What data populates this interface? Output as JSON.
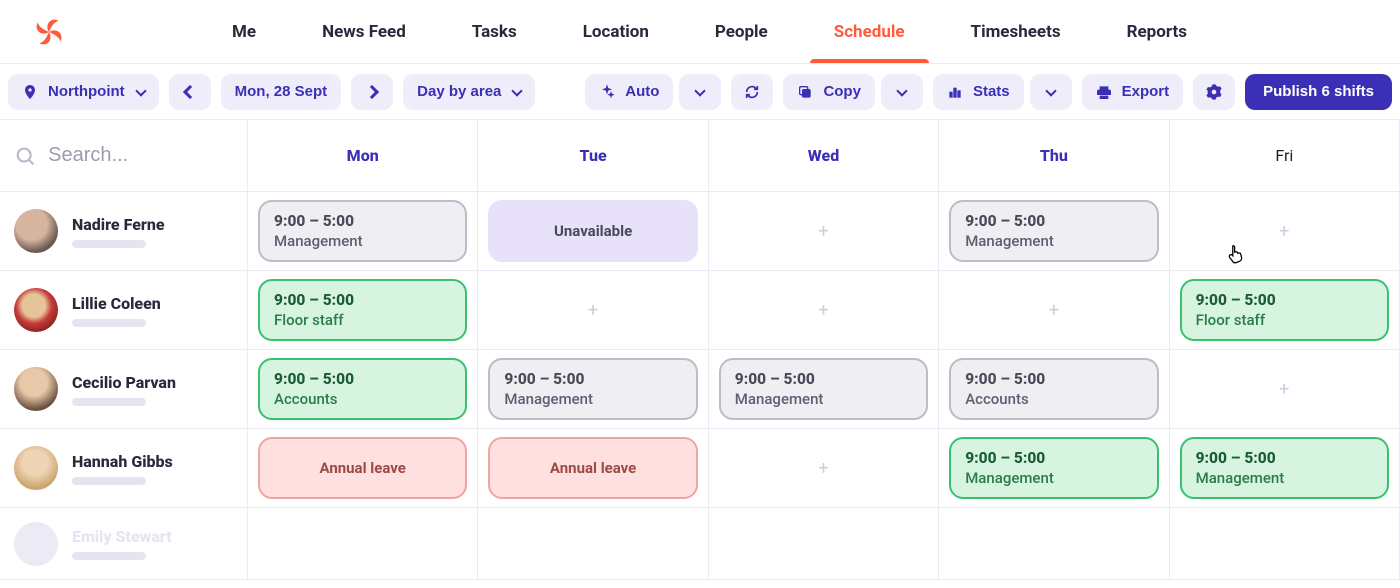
{
  "nav": {
    "tabs": [
      {
        "label": "Me",
        "active": false
      },
      {
        "label": "News Feed",
        "active": false
      },
      {
        "label": "Tasks",
        "active": false
      },
      {
        "label": "Location",
        "active": false
      },
      {
        "label": "People",
        "active": false
      },
      {
        "label": "Schedule",
        "active": true
      },
      {
        "label": "Timesheets",
        "active": false
      },
      {
        "label": "Reports",
        "active": false
      }
    ]
  },
  "toolbar": {
    "location": "Northpoint",
    "date": "Mon, 28 Sept",
    "view": "Day by area",
    "auto": "Auto",
    "copy": "Copy",
    "stats": "Stats",
    "export": "Export",
    "publish": "Publish 6 shifts"
  },
  "search": {
    "placeholder": "Search..."
  },
  "days": [
    "Mon",
    "Tue",
    "Wed",
    "Thu",
    "Fri"
  ],
  "people": [
    {
      "name": "Nadire Ferne",
      "avatar": "av1"
    },
    {
      "name": "Lillie Coleen",
      "avatar": "av2"
    },
    {
      "name": "Cecilio Parvan",
      "avatar": "av3"
    },
    {
      "name": "Hannah Gibbs",
      "avatar": "av4"
    },
    {
      "name": "Emily Stewart",
      "avatar": "av5"
    }
  ],
  "shift_types": {
    "gray": {
      "bg": "#efeef2",
      "border": "#bdbcc7"
    },
    "lav": {
      "bg": "#e7e1fa"
    },
    "green": {
      "bg": "#d7f4e0",
      "border": "#38c26e"
    },
    "red": {
      "bg": "#fde0df",
      "border": "#f1a5a1"
    }
  },
  "schedule": [
    [
      {
        "type": "gray",
        "time": "9:00 – 5:00",
        "role": "Management"
      },
      {
        "type": "lav",
        "centered": true,
        "role": "Unavailable"
      },
      {
        "type": "empty"
      },
      {
        "type": "gray",
        "time": "9:00 – 5:00",
        "role": "Management",
        "cursor": true
      },
      {
        "type": "empty"
      }
    ],
    [
      {
        "type": "green",
        "time": "9:00 – 5:00",
        "role": "Floor staff"
      },
      {
        "type": "empty"
      },
      {
        "type": "empty"
      },
      {
        "type": "empty"
      },
      {
        "type": "green",
        "time": "9:00 – 5:00",
        "role": "Floor staff"
      }
    ],
    [
      {
        "type": "green",
        "time": "9:00 – 5:00",
        "role": "Accounts"
      },
      {
        "type": "gray",
        "time": "9:00 – 5:00",
        "role": "Management"
      },
      {
        "type": "gray",
        "time": "9:00 – 5:00",
        "role": "Management"
      },
      {
        "type": "gray",
        "time": "9:00 – 5:00",
        "role": "Accounts"
      },
      {
        "type": "empty"
      }
    ],
    [
      {
        "type": "red",
        "centered": true,
        "role": "Annual leave"
      },
      {
        "type": "red",
        "centered": true,
        "role": "Annual leave"
      },
      {
        "type": "empty"
      },
      {
        "type": "green",
        "time": "9:00 – 5:00",
        "role": "Management"
      },
      {
        "type": "green",
        "time": "9:00 – 5:00",
        "role": "Management"
      }
    ],
    [
      {
        "type": "blank"
      },
      {
        "type": "blank"
      },
      {
        "type": "blank"
      },
      {
        "type": "blank"
      },
      {
        "type": "blank"
      }
    ]
  ]
}
